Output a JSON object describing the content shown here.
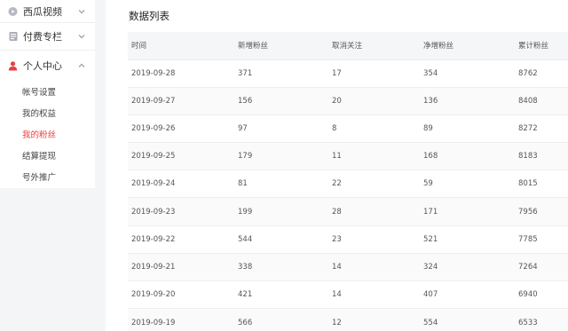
{
  "sidebar": {
    "groups": [
      {
        "label": "西瓜视频",
        "icon": "watermelon-video-icon"
      },
      {
        "label": "付费专栏",
        "icon": "document-icon"
      },
      {
        "label": "个人中心",
        "icon": "user-icon"
      }
    ],
    "sub_items": [
      "帐号设置",
      "我的权益",
      "我的粉丝",
      "结算提现",
      "号外推广"
    ],
    "active_sub": "我的粉丝",
    "accent": "#e8413d"
  },
  "main": {
    "title": "数据列表",
    "columns": [
      "时间",
      "新增粉丝",
      "取消关注",
      "净增粉丝",
      "累计粉丝"
    ],
    "rows": [
      [
        "2019-09-28",
        "371",
        "17",
        "354",
        "8762"
      ],
      [
        "2019-09-27",
        "156",
        "20",
        "136",
        "8408"
      ],
      [
        "2019-09-26",
        "97",
        "8",
        "89",
        "8272"
      ],
      [
        "2019-09-25",
        "179",
        "11",
        "168",
        "8183"
      ],
      [
        "2019-09-24",
        "81",
        "22",
        "59",
        "8015"
      ],
      [
        "2019-09-23",
        "199",
        "28",
        "171",
        "7956"
      ],
      [
        "2019-09-22",
        "544",
        "23",
        "521",
        "7785"
      ],
      [
        "2019-09-21",
        "338",
        "14",
        "324",
        "7264"
      ],
      [
        "2019-09-20",
        "421",
        "14",
        "407",
        "6940"
      ],
      [
        "2019-09-19",
        "566",
        "12",
        "554",
        "6533"
      ]
    ]
  }
}
